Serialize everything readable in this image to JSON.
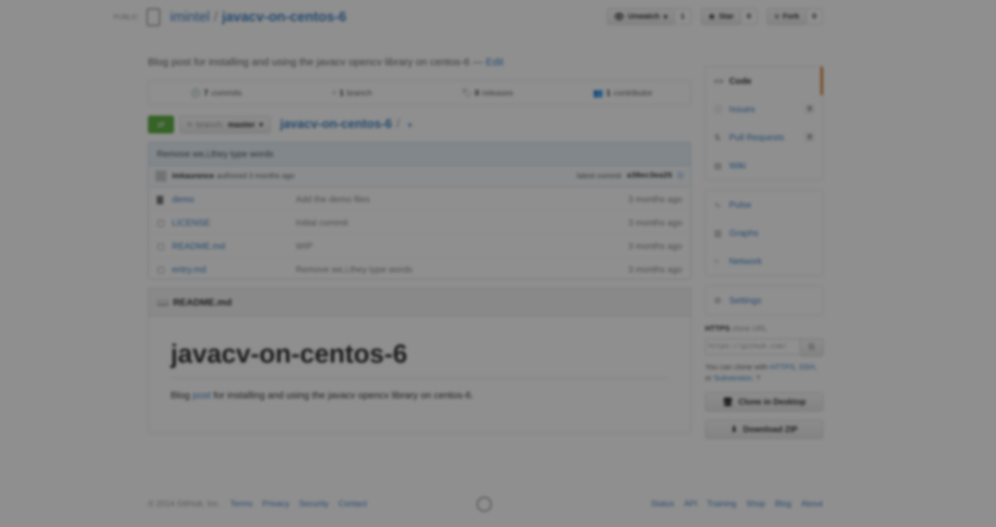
{
  "header": {
    "visibility": "PUBLIC",
    "owner": "imintel",
    "separator": "/",
    "repo": "javacv-on-centos-6",
    "unwatch_label": "Unwatch",
    "unwatch_count": "1",
    "star_label": "Star",
    "star_count": "0",
    "fork_label": "Fork",
    "fork_count": "0"
  },
  "description": {
    "text": "Blog post for installing and using the javacv opencv library on centos-6",
    "edit_sep": "—",
    "edit": "Edit"
  },
  "summary": [
    {
      "count": "7",
      "label": "commits"
    },
    {
      "count": "1",
      "label": "branch"
    },
    {
      "count": "0",
      "label": "releases"
    },
    {
      "count": "1",
      "label": "contributor"
    }
  ],
  "filenav": {
    "branch_label": "branch:",
    "branch": "master",
    "path": "javacv-on-centos-6",
    "path_sep": "/",
    "plus": "+"
  },
  "commit": {
    "title": "Remove we,i,they type words",
    "author": "imkaurence",
    "authored": "authored 3 months ago",
    "latest_label": "latest commit",
    "sha": "a38ec3ea25"
  },
  "files": [
    {
      "icon": "directory-icon",
      "name": "demo",
      "message": "Add the demo files",
      "age": "3 months ago"
    },
    {
      "icon": "file-icon",
      "name": "LICENSE",
      "message": "Initial commit",
      "age": "3 months ago"
    },
    {
      "icon": "file-icon",
      "name": "README.md",
      "message": "WIP",
      "age": "3 months ago"
    },
    {
      "icon": "file-icon",
      "name": "entry.md",
      "message": "Remove we,i,they type words",
      "age": "3 months ago"
    }
  ],
  "readme": {
    "header": "README.md",
    "title": "javacv-on-centos-6",
    "p_before": "Blog ",
    "p_link": "post",
    "p_after": " for installing and using the javacv opencv library on centos-6."
  },
  "sidebar": {
    "nav1": [
      {
        "label": "Code",
        "count": ""
      },
      {
        "label": "Issues",
        "count": "0"
      },
      {
        "label": "Pull Requests",
        "count": "0"
      },
      {
        "label": "Wiki",
        "count": ""
      }
    ],
    "nav2": [
      {
        "label": "Pulse"
      },
      {
        "label": "Graphs"
      },
      {
        "label": "Network"
      }
    ],
    "nav3": [
      {
        "label": "Settings"
      }
    ],
    "clone_proto": "HTTPS",
    "clone_suffix": "clone URL",
    "clone_url": "https://github.com/",
    "clone_help_1": "You can clone with",
    "clone_help_https": "HTTPS",
    "clone_help_ssh": "SSH",
    "clone_help_or": "or",
    "clone_help_sub": "Subversion",
    "clone_desktop": "Clone in Desktop",
    "download_zip": "Download ZIP"
  },
  "footer": {
    "copyright": "© 2014 GitHub, Inc.",
    "left_links": [
      "Terms",
      "Privacy",
      "Security",
      "Contact"
    ],
    "right_links": [
      "Status",
      "API",
      "Training",
      "Shop",
      "Blog",
      "About"
    ]
  },
  "colors": {
    "link": "#4183c4",
    "compare": "#60b044",
    "selected_nav": "#d26911",
    "overlay": "rgba(0,0,0,0.44)"
  }
}
